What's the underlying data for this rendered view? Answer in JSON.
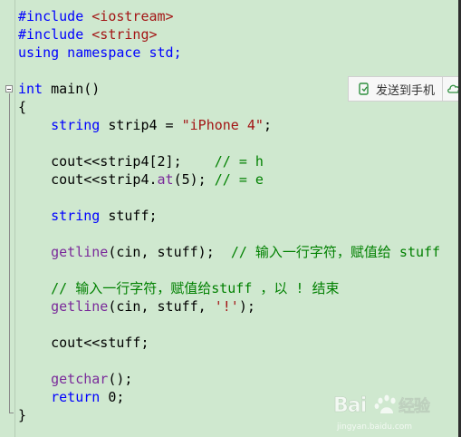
{
  "code_lines": [
    {
      "parts": [
        {
          "t": "#include ",
          "c": "kw"
        },
        {
          "t": "<iostream>",
          "c": "str"
        }
      ]
    },
    {
      "parts": [
        {
          "t": "#include ",
          "c": "kw"
        },
        {
          "t": "<string>",
          "c": "str"
        }
      ]
    },
    {
      "parts": [
        {
          "t": "using namespace std;",
          "c": "kw"
        }
      ]
    },
    {
      "parts": []
    },
    {
      "parts": [
        {
          "t": "int",
          "c": "kw"
        },
        {
          "t": " main()",
          "c": ""
        }
      ]
    },
    {
      "parts": [
        {
          "t": "{",
          "c": ""
        }
      ]
    },
    {
      "parts": [
        {
          "t": "    ",
          "c": ""
        },
        {
          "t": "string",
          "c": "kw"
        },
        {
          "t": " strip4 = ",
          "c": ""
        },
        {
          "t": "\"iPhone 4\"",
          "c": "str"
        },
        {
          "t": ";",
          "c": ""
        }
      ]
    },
    {
      "parts": []
    },
    {
      "parts": [
        {
          "t": "    cout<<strip4[2];    ",
          "c": ""
        },
        {
          "t": "// = h",
          "c": "cm"
        }
      ]
    },
    {
      "parts": [
        {
          "t": "    cout<<strip4.",
          "c": ""
        },
        {
          "t": "at",
          "c": "fn"
        },
        {
          "t": "(5); ",
          "c": ""
        },
        {
          "t": "// = e",
          "c": "cm"
        }
      ]
    },
    {
      "parts": []
    },
    {
      "parts": [
        {
          "t": "    ",
          "c": ""
        },
        {
          "t": "string",
          "c": "kw"
        },
        {
          "t": " stuff;",
          "c": ""
        }
      ]
    },
    {
      "parts": []
    },
    {
      "parts": [
        {
          "t": "    ",
          "c": ""
        },
        {
          "t": "getline",
          "c": "fn"
        },
        {
          "t": "(cin, stuff);  ",
          "c": ""
        },
        {
          "t": "// 输入一行字符，赋值给 stuff",
          "c": "cm"
        }
      ]
    },
    {
      "parts": []
    },
    {
      "parts": [
        {
          "t": "    ",
          "c": ""
        },
        {
          "t": "// 输入一行字符，赋值给stuff ，以 ! 结束",
          "c": "cm"
        }
      ]
    },
    {
      "parts": [
        {
          "t": "    ",
          "c": ""
        },
        {
          "t": "getline",
          "c": "fn"
        },
        {
          "t": "(cin, stuff, ",
          "c": ""
        },
        {
          "t": "'!'",
          "c": "str"
        },
        {
          "t": ");",
          "c": ""
        }
      ]
    },
    {
      "parts": []
    },
    {
      "parts": [
        {
          "t": "    cout<<stuff;",
          "c": ""
        }
      ]
    },
    {
      "parts": []
    },
    {
      "parts": [
        {
          "t": "    ",
          "c": ""
        },
        {
          "t": "getchar",
          "c": "fn"
        },
        {
          "t": "();",
          "c": ""
        }
      ]
    },
    {
      "parts": [
        {
          "t": "    ",
          "c": ""
        },
        {
          "t": "return",
          "c": "kw"
        },
        {
          "t": " 0;",
          "c": ""
        }
      ]
    },
    {
      "parts": [
        {
          "t": "}",
          "c": ""
        }
      ]
    }
  ],
  "toolbar": {
    "send_label": "发送到手机",
    "send_icon": "phone-send-icon",
    "cloud_icon": "cloud-icon"
  },
  "watermark": {
    "logo_text": "Bai 经验",
    "sub_text": "jingyan.baidu.com"
  },
  "colors": {
    "editor_bg": "#cfe8cf",
    "keyword": "#0000ff",
    "string": "#a31515",
    "comment": "#008000",
    "function": "#7a2a9a"
  }
}
